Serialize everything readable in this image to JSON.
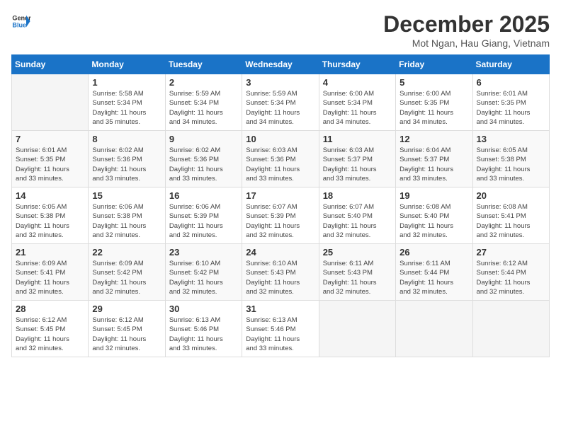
{
  "header": {
    "logo_line1": "General",
    "logo_line2": "Blue",
    "month_year": "December 2025",
    "location": "Mot Ngan, Hau Giang, Vietnam"
  },
  "days_of_week": [
    "Sunday",
    "Monday",
    "Tuesday",
    "Wednesday",
    "Thursday",
    "Friday",
    "Saturday"
  ],
  "weeks": [
    [
      {
        "day": "",
        "info": ""
      },
      {
        "day": "1",
        "info": "Sunrise: 5:58 AM\nSunset: 5:34 PM\nDaylight: 11 hours\nand 35 minutes."
      },
      {
        "day": "2",
        "info": "Sunrise: 5:59 AM\nSunset: 5:34 PM\nDaylight: 11 hours\nand 34 minutes."
      },
      {
        "day": "3",
        "info": "Sunrise: 5:59 AM\nSunset: 5:34 PM\nDaylight: 11 hours\nand 34 minutes."
      },
      {
        "day": "4",
        "info": "Sunrise: 6:00 AM\nSunset: 5:34 PM\nDaylight: 11 hours\nand 34 minutes."
      },
      {
        "day": "5",
        "info": "Sunrise: 6:00 AM\nSunset: 5:35 PM\nDaylight: 11 hours\nand 34 minutes."
      },
      {
        "day": "6",
        "info": "Sunrise: 6:01 AM\nSunset: 5:35 PM\nDaylight: 11 hours\nand 34 minutes."
      }
    ],
    [
      {
        "day": "7",
        "info": "Sunrise: 6:01 AM\nSunset: 5:35 PM\nDaylight: 11 hours\nand 33 minutes."
      },
      {
        "day": "8",
        "info": "Sunrise: 6:02 AM\nSunset: 5:36 PM\nDaylight: 11 hours\nand 33 minutes."
      },
      {
        "day": "9",
        "info": "Sunrise: 6:02 AM\nSunset: 5:36 PM\nDaylight: 11 hours\nand 33 minutes."
      },
      {
        "day": "10",
        "info": "Sunrise: 6:03 AM\nSunset: 5:36 PM\nDaylight: 11 hours\nand 33 minutes."
      },
      {
        "day": "11",
        "info": "Sunrise: 6:03 AM\nSunset: 5:37 PM\nDaylight: 11 hours\nand 33 minutes."
      },
      {
        "day": "12",
        "info": "Sunrise: 6:04 AM\nSunset: 5:37 PM\nDaylight: 11 hours\nand 33 minutes."
      },
      {
        "day": "13",
        "info": "Sunrise: 6:05 AM\nSunset: 5:38 PM\nDaylight: 11 hours\nand 33 minutes."
      }
    ],
    [
      {
        "day": "14",
        "info": "Sunrise: 6:05 AM\nSunset: 5:38 PM\nDaylight: 11 hours\nand 32 minutes."
      },
      {
        "day": "15",
        "info": "Sunrise: 6:06 AM\nSunset: 5:38 PM\nDaylight: 11 hours\nand 32 minutes."
      },
      {
        "day": "16",
        "info": "Sunrise: 6:06 AM\nSunset: 5:39 PM\nDaylight: 11 hours\nand 32 minutes."
      },
      {
        "day": "17",
        "info": "Sunrise: 6:07 AM\nSunset: 5:39 PM\nDaylight: 11 hours\nand 32 minutes."
      },
      {
        "day": "18",
        "info": "Sunrise: 6:07 AM\nSunset: 5:40 PM\nDaylight: 11 hours\nand 32 minutes."
      },
      {
        "day": "19",
        "info": "Sunrise: 6:08 AM\nSunset: 5:40 PM\nDaylight: 11 hours\nand 32 minutes."
      },
      {
        "day": "20",
        "info": "Sunrise: 6:08 AM\nSunset: 5:41 PM\nDaylight: 11 hours\nand 32 minutes."
      }
    ],
    [
      {
        "day": "21",
        "info": "Sunrise: 6:09 AM\nSunset: 5:41 PM\nDaylight: 11 hours\nand 32 minutes."
      },
      {
        "day": "22",
        "info": "Sunrise: 6:09 AM\nSunset: 5:42 PM\nDaylight: 11 hours\nand 32 minutes."
      },
      {
        "day": "23",
        "info": "Sunrise: 6:10 AM\nSunset: 5:42 PM\nDaylight: 11 hours\nand 32 minutes."
      },
      {
        "day": "24",
        "info": "Sunrise: 6:10 AM\nSunset: 5:43 PM\nDaylight: 11 hours\nand 32 minutes."
      },
      {
        "day": "25",
        "info": "Sunrise: 6:11 AM\nSunset: 5:43 PM\nDaylight: 11 hours\nand 32 minutes."
      },
      {
        "day": "26",
        "info": "Sunrise: 6:11 AM\nSunset: 5:44 PM\nDaylight: 11 hours\nand 32 minutes."
      },
      {
        "day": "27",
        "info": "Sunrise: 6:12 AM\nSunset: 5:44 PM\nDaylight: 11 hours\nand 32 minutes."
      }
    ],
    [
      {
        "day": "28",
        "info": "Sunrise: 6:12 AM\nSunset: 5:45 PM\nDaylight: 11 hours\nand 32 minutes."
      },
      {
        "day": "29",
        "info": "Sunrise: 6:12 AM\nSunset: 5:45 PM\nDaylight: 11 hours\nand 32 minutes."
      },
      {
        "day": "30",
        "info": "Sunrise: 6:13 AM\nSunset: 5:46 PM\nDaylight: 11 hours\nand 33 minutes."
      },
      {
        "day": "31",
        "info": "Sunrise: 6:13 AM\nSunset: 5:46 PM\nDaylight: 11 hours\nand 33 minutes."
      },
      {
        "day": "",
        "info": ""
      },
      {
        "day": "",
        "info": ""
      },
      {
        "day": "",
        "info": ""
      }
    ]
  ]
}
